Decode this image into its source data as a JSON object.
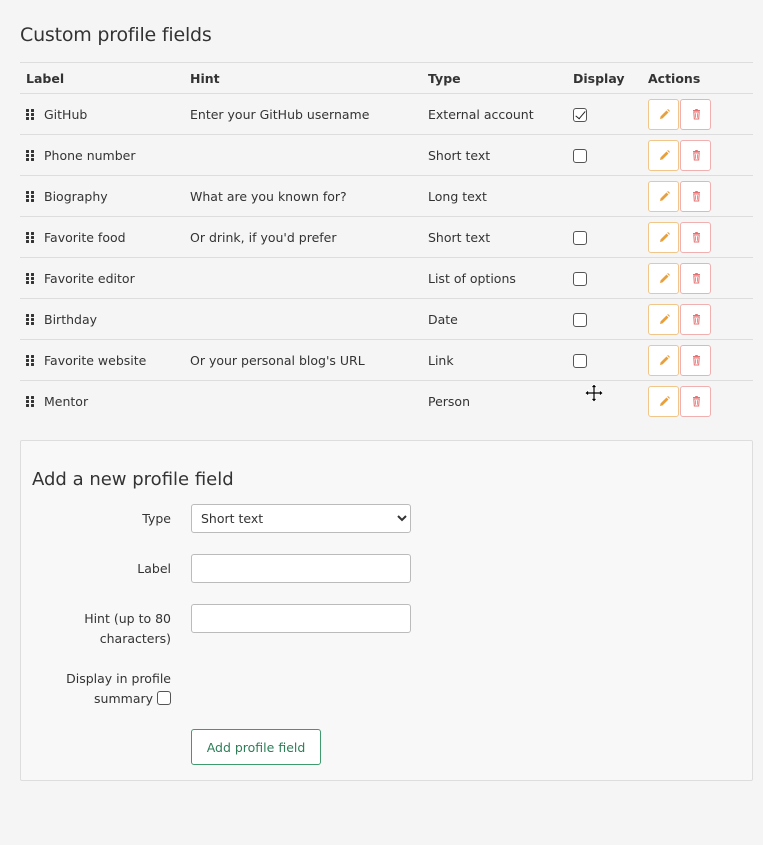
{
  "page_title": "Custom profile fields",
  "table": {
    "headers": {
      "label": "Label",
      "hint": "Hint",
      "type": "Type",
      "display": "Display",
      "actions": "Actions"
    },
    "rows": [
      {
        "label": "GitHub",
        "hint": "Enter your GitHub username",
        "type": "External account",
        "display": "checked"
      },
      {
        "label": "Phone number",
        "hint": "",
        "type": "Short text",
        "display": "unchecked"
      },
      {
        "label": "Biography",
        "hint": "What are you known for?",
        "type": "Long text",
        "display": "none"
      },
      {
        "label": "Favorite food",
        "hint": "Or drink, if you'd prefer",
        "type": "Short text",
        "display": "unchecked"
      },
      {
        "label": "Favorite editor",
        "hint": "",
        "type": "List of options",
        "display": "unchecked"
      },
      {
        "label": "Birthday",
        "hint": "",
        "type": "Date",
        "display": "unchecked"
      },
      {
        "label": "Favorite website",
        "hint": "Or your personal blog's URL",
        "type": "Link",
        "display": "unchecked"
      },
      {
        "label": "Mentor",
        "hint": "",
        "type": "Person",
        "display": "none"
      }
    ]
  },
  "add_form": {
    "title": "Add a new profile field",
    "type_label": "Type",
    "type_value": "Short text",
    "type_options": [
      "Short text"
    ],
    "label_label": "Label",
    "label_value": "",
    "hint_label_line1": "Hint (up to 80",
    "hint_label_line2": "characters)",
    "hint_value": "",
    "display_label_line1": "Display in profile",
    "display_label_line2": "summary",
    "submit_label": "Add profile field"
  },
  "colors": {
    "edit_accent": "#e8a03c",
    "delete_accent": "#e57373",
    "submit_accent": "#2e7d58"
  },
  "icons": {
    "drag": "drag-handle-icon",
    "edit": "pencil-icon",
    "delete": "trash-icon",
    "cursor": "move-cursor-icon"
  }
}
